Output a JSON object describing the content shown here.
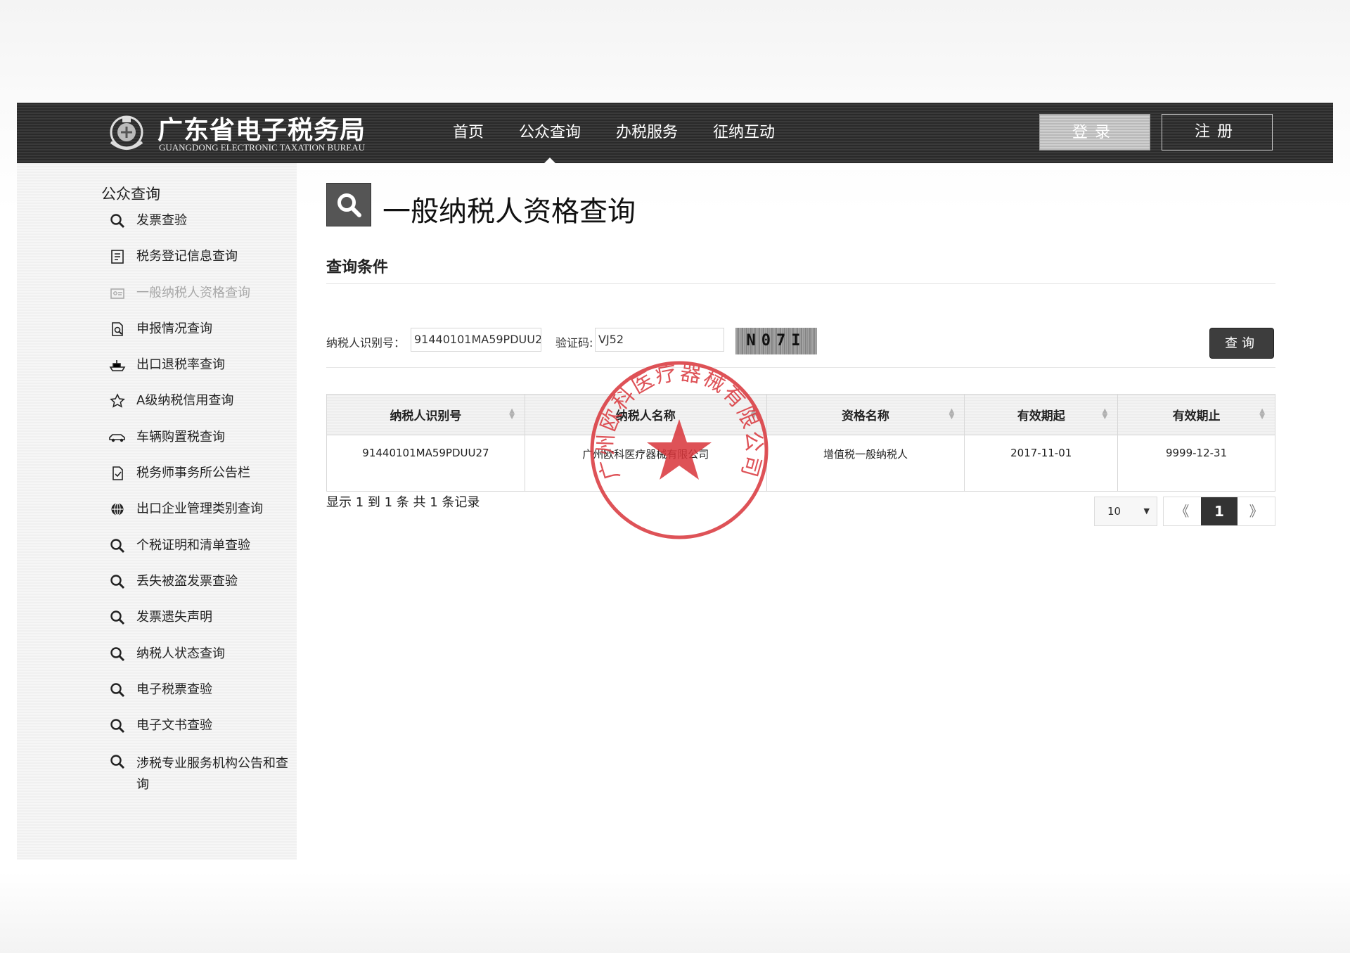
{
  "header": {
    "title": "广东省电子税务局",
    "subtitle": "GUANGDONG ELECTRONIC TAXATION BUREAU",
    "nav": [
      {
        "label": "首页"
      },
      {
        "label": "公众查询"
      },
      {
        "label": "办税服务"
      },
      {
        "label": "征纳互动"
      }
    ],
    "active_nav": "公众查询",
    "login_label": "登录",
    "register_label": "注册"
  },
  "sidebar": {
    "title": "公众查询",
    "items": [
      {
        "label": "发票查验",
        "icon": "search-icon"
      },
      {
        "label": "税务登记信息查询",
        "icon": "register-icon"
      },
      {
        "label": "一般纳税人资格查询",
        "icon": "id-card-icon",
        "disabled": true
      },
      {
        "label": "申报情况查询",
        "icon": "document-search-icon"
      },
      {
        "label": "出口退税率查询",
        "icon": "ship-icon"
      },
      {
        "label": "A级纳税信用查询",
        "icon": "star-icon"
      },
      {
        "label": "车辆购置税查询",
        "icon": "car-icon"
      },
      {
        "label": "税务师事务所公告栏",
        "icon": "notice-icon"
      },
      {
        "label": "出口企业管理类别查询",
        "icon": "globe-icon"
      },
      {
        "label": "个税证明和清单查验",
        "icon": "search-icon"
      },
      {
        "label": "丢失被盗发票查验",
        "icon": "search-icon"
      },
      {
        "label": "发票遗失声明",
        "icon": "search-icon"
      },
      {
        "label": "纳税人状态查询",
        "icon": "search-icon"
      },
      {
        "label": "电子税票查验",
        "icon": "search-icon"
      },
      {
        "label": "电子文书查验",
        "icon": "search-icon"
      },
      {
        "label": "涉税专业服务机构公告和查询",
        "icon": "search-icon"
      }
    ]
  },
  "main": {
    "title": "一般纳税人资格查询",
    "conditions_title": "查询条件",
    "form": {
      "taxpayer_id_label": "纳税人识别号：",
      "taxpayer_id_value": "91440101MA59PDUU2",
      "captcha_label": "验证码:",
      "captcha_value": "VJ52",
      "captcha_image_text": "N07I",
      "query_label": "查询"
    },
    "table": {
      "headers": [
        "纳税人识别号",
        "纳税人名称",
        "资格名称",
        "有效期起",
        "有效期止"
      ],
      "rows": [
        [
          "91440101MA59PDUU27",
          "广州欧科医疗器械有限公司",
          "增值税一般纳税人",
          "2017-11-01",
          "9999-12-31"
        ]
      ]
    },
    "summary": "显示 1 到 1 条 共 1 条记录",
    "page_size": "10",
    "pager": {
      "prev": "《",
      "current": "1",
      "next": "》"
    }
  },
  "stamp": {
    "text": "广州欧科医疗器械有限公司",
    "color": "#d9343a"
  },
  "colors": {
    "header_bg": "#333333",
    "stamp_red": "#d9343a"
  }
}
